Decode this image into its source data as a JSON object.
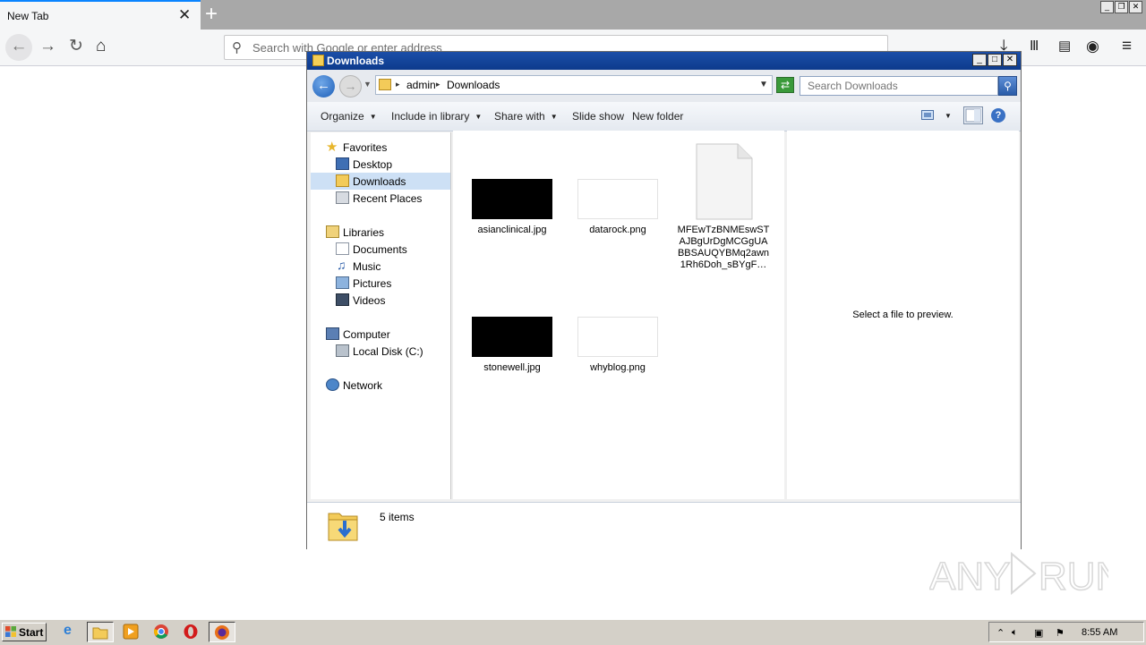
{
  "browser": {
    "tab_title": "New Tab",
    "url_placeholder": "Search with Google or enter address"
  },
  "explorer": {
    "title": "Downloads",
    "breadcrumb": [
      "admin",
      "Downloads"
    ],
    "search_placeholder": "Search Downloads",
    "commands": {
      "organize": "Organize",
      "include_in_library": "Include in library",
      "share_with": "Share with",
      "slide_show": "Slide show",
      "new_folder": "New folder"
    },
    "nav": {
      "favorites": "Favorites",
      "desktop": "Desktop",
      "downloads": "Downloads",
      "recent_places": "Recent Places",
      "libraries": "Libraries",
      "documents": "Documents",
      "music": "Music",
      "pictures": "Pictures",
      "videos": "Videos",
      "computer": "Computer",
      "local_disk": "Local Disk (C:)",
      "network": "Network"
    },
    "files": [
      {
        "name": "asianclinical.jpg",
        "thumb": "black"
      },
      {
        "name": "datarock.png",
        "thumb": "white"
      },
      {
        "name": "MFEwTzBNMEswSTAJBgUrDgMCGgUABBSAUQYBMq2awn1Rh6Doh_sBYgF…",
        "thumb": "document"
      },
      {
        "name": "stonewell.jpg",
        "thumb": "black"
      },
      {
        "name": "whyblog.png",
        "thumb": "white"
      }
    ],
    "preview_text": "Select a file to preview.",
    "item_count": "5 items"
  },
  "taskbar": {
    "start_label": "Start",
    "clock": "8:55 AM"
  },
  "colors": {
    "title_bar": "#0d3b8c",
    "selection": "#cde0f5",
    "accent": "#0a84ff"
  }
}
